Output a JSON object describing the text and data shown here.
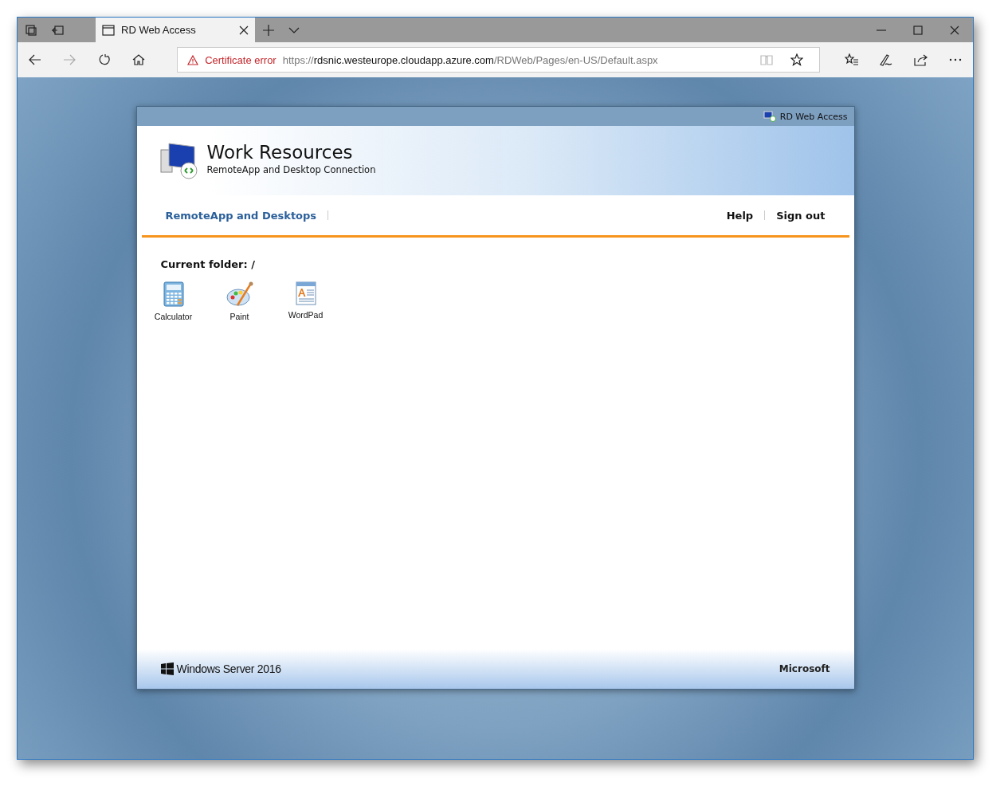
{
  "browser": {
    "tab": {
      "title": "RD Web Access",
      "selected": true
    },
    "address": {
      "warning": "Certificate error",
      "url": {
        "scheme": "https://",
        "host": "rdsnic.westeurope.cloudapp.azure.com",
        "path": "/RDWeb/Pages/en-US/Default.aspx"
      }
    }
  },
  "page": {
    "top_bar": "RD Web Access",
    "title": "Work Resources",
    "subtitle": "RemoteApp and Desktop Connection",
    "nav": {
      "left": [
        {
          "label": "RemoteApp and Desktops",
          "selected": true
        }
      ],
      "right": [
        {
          "label": "Help"
        },
        {
          "label": "Sign out"
        }
      ]
    },
    "folder": "Current folder: /",
    "apps": [
      {
        "label": "Calculator",
        "kind": "calculator"
      },
      {
        "label": "Paint",
        "kind": "paint"
      },
      {
        "label": "WordPad",
        "kind": "wordpad"
      }
    ],
    "footer": {
      "product": "Windows Server 2016",
      "brand": "Microsoft"
    }
  }
}
